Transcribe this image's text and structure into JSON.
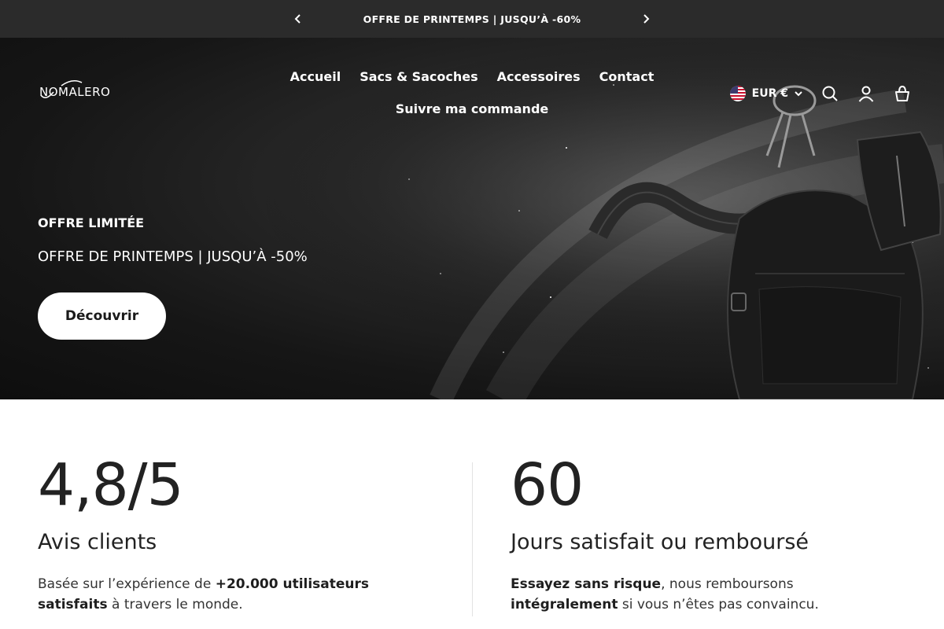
{
  "announcement": {
    "text": "OFFRE DE PRINTEMPS | JUSQU’À -60%",
    "prev_icon": "chevron-left-icon",
    "next_icon": "chevron-right-icon"
  },
  "header": {
    "logo": "NOMALERO",
    "nav": [
      {
        "label": "Accueil"
      },
      {
        "label": "Sacs & Sacoches"
      },
      {
        "label": "Accessoires"
      },
      {
        "label": "Contact"
      },
      {
        "label": "Suivre ma commande"
      }
    ],
    "currency": "EUR €",
    "icons": [
      "us-flag-icon",
      "chevron-down-icon",
      "search-icon",
      "account-icon",
      "cart-icon"
    ]
  },
  "hero": {
    "eyebrow": "OFFRE LIMITÉE",
    "subtitle": "OFFRE DE PRINTEMPS | JUSQU’À -50%",
    "cta": "Découvrir"
  },
  "stats": [
    {
      "value": "4,8/5",
      "label": "Avis clients",
      "desc_pre": "Basée sur l’expérience de ",
      "desc_bold": "+20.000 utilisateurs satisfaits",
      "desc_post": " à travers le monde."
    },
    {
      "value": "60",
      "label": "Jours satisfait ou remboursé",
      "desc_bold1": "Essayez sans risque",
      "desc_mid": ", nous remboursons ",
      "desc_bold2": "intégralement",
      "desc_post": " si vous n’êtes pas convaincu."
    }
  ],
  "colors": {
    "announcement_bg": "#2b2b2b",
    "hero_bg": "#161616",
    "cta_bg": "#ffffff",
    "text_dark": "#222222"
  }
}
